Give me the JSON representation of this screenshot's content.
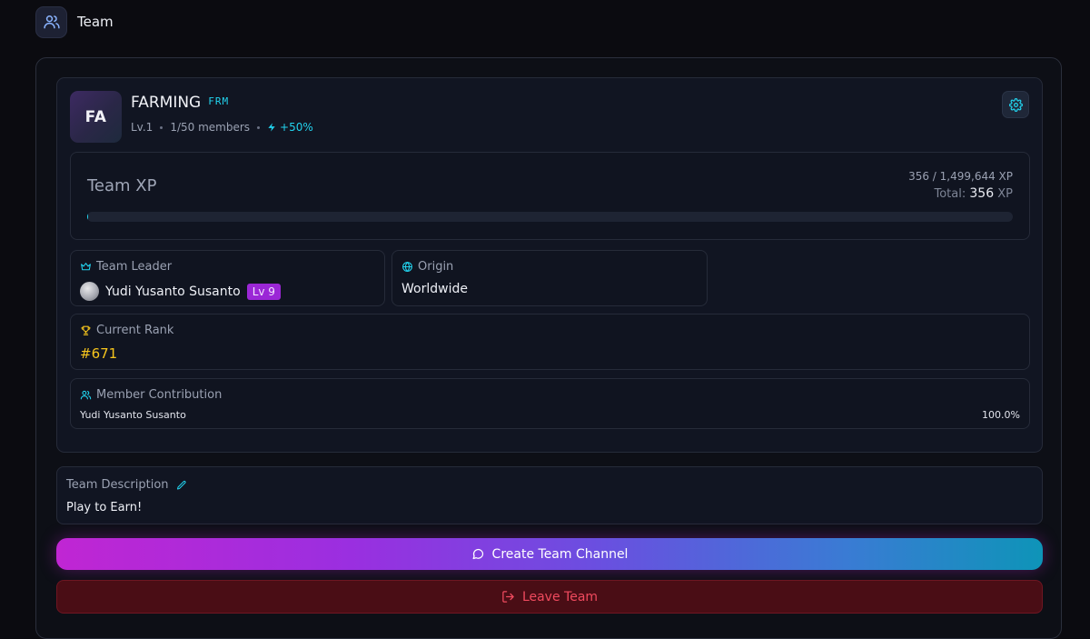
{
  "header": {
    "title": "Team",
    "icon": "users-icon"
  },
  "team": {
    "initials": "FA",
    "name": "FARMING",
    "tag": "FRM",
    "level": "Lv.1",
    "members": "1/50 members",
    "boost": "+50%",
    "settings_icon": "gear-icon"
  },
  "xp": {
    "label": "Team XP",
    "progress_text": "356 / 1,499,644 XP",
    "total_label": "Total:",
    "total_value": "356",
    "total_unit": "XP",
    "fill_fraction": 0.0002
  },
  "leader": {
    "heading": "Team Leader",
    "name": "Yudi Yusanto Susanto",
    "level_badge": "Lv 9"
  },
  "origin": {
    "heading": "Origin",
    "value": "Worldwide"
  },
  "rank": {
    "heading": "Current Rank",
    "value": "#671"
  },
  "contribution": {
    "heading": "Member Contribution",
    "rows": [
      {
        "name": "Yudi Yusanto Susanto",
        "percent": "100.0%"
      }
    ]
  },
  "description": {
    "heading": "Team Description",
    "text": "Play to Earn!"
  },
  "actions": {
    "create_channel": "Create Team Channel",
    "leave": "Leave Team"
  },
  "colors": {
    "accent_cyan": "#22d3ee",
    "rank_gold": "#f6c51d",
    "level_badge": "#9b27d6",
    "danger": "#f04a5e"
  }
}
